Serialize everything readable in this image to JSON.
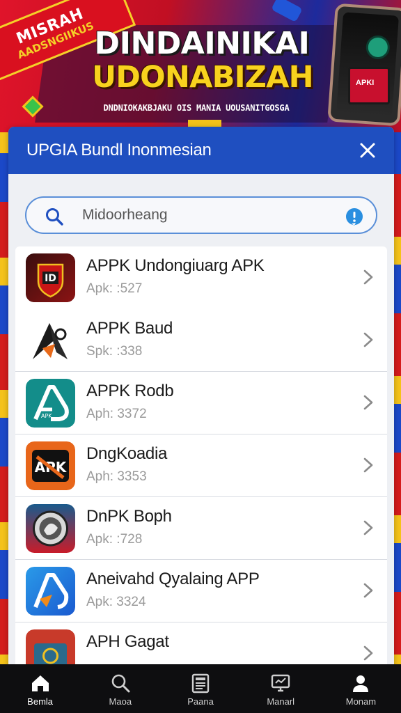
{
  "banner": {
    "ribbon_line1": "MISRAH",
    "ribbon_line2": "AADSNGIIKUS",
    "title": "DINDAINIKAI",
    "subtitle": "UDONABIZAH",
    "tagline": "DNDNIOKAKBJAKU OIS MANIA UOUSANITGOSGA",
    "box_label": "APKI"
  },
  "panel": {
    "title": "UPGIA Bundl Inonmesian",
    "close_icon": "close-icon"
  },
  "search": {
    "placeholder": "Midoorheang",
    "icon": "search-icon",
    "info_icon": "info-icon",
    "accent": "#2a8fe0"
  },
  "apps": [
    {
      "name": "APPK Undongiuarg APK",
      "meta": "Apk: :527",
      "icon": "shield-badge-app-icon"
    },
    {
      "name": "APPK Baud",
      "meta": "Spk: :338",
      "icon": "a-arrow-app-icon"
    },
    {
      "name": "APPK Rodb",
      "meta": "Aph: 3372",
      "icon": "teal-a-app-icon"
    },
    {
      "name": "DngKoadia",
      "meta": "Aph: 3353",
      "icon": "orange-apk-app-icon"
    },
    {
      "name": "DnPK Boph",
      "meta": "Apk: :728",
      "icon": "lion-emblem-app-icon"
    },
    {
      "name": "Aneivahd Qyalaing APP",
      "meta": "Apk: 3324",
      "icon": "blue-a-app-icon"
    },
    {
      "name": "APH Gagat",
      "meta": "",
      "icon": "red-cube-app-icon"
    }
  ],
  "nav": [
    {
      "label": "Bemla",
      "icon": "home-icon",
      "active": true
    },
    {
      "label": "Maoa",
      "icon": "search-icon",
      "active": false
    },
    {
      "label": "Paana",
      "icon": "document-icon",
      "active": false
    },
    {
      "label": "Manarl",
      "icon": "monitor-icon",
      "active": false
    },
    {
      "label": "Monam",
      "icon": "person-icon",
      "active": false
    }
  ],
  "colors": {
    "header_blue": "#1f4fc0",
    "banner_red": "#c8102e",
    "banner_yellow": "#f8d21e",
    "nav_bg": "#0e0e10"
  }
}
